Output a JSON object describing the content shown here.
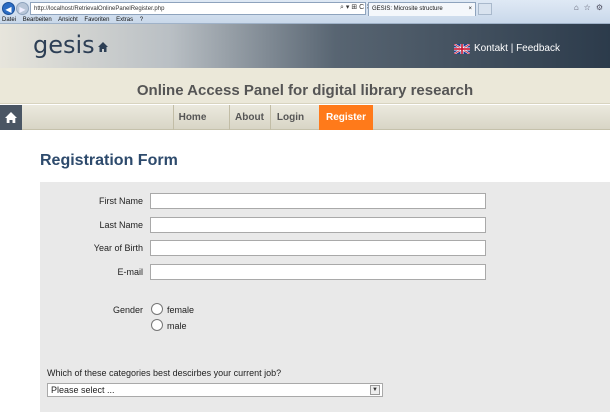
{
  "browser": {
    "url": "http://localhost/RetrievalOnlinePanelRegister.php",
    "address_tools": "⌕ ▾ ⊞ C ✕",
    "tab_title": "GESIS: Microsite structure",
    "tab_close": "×",
    "menu": [
      "Datei",
      "Bearbeiten",
      "Ansicht",
      "Favoriten",
      "Extras",
      "?"
    ]
  },
  "site": {
    "logo_text": "gesis",
    "contact_text": "Kontakt | Feedback",
    "banner_title": "Online Access Panel for digital library research"
  },
  "nav": {
    "items": [
      {
        "label": "Home"
      },
      {
        "label": "About"
      },
      {
        "label": "Login"
      },
      {
        "label": "Register",
        "active": true
      }
    ]
  },
  "form": {
    "title": "Registration Form",
    "fields": {
      "first_name": {
        "label": "First Name",
        "value": ""
      },
      "last_name": {
        "label": "Last Name",
        "value": ""
      },
      "year_of_birth": {
        "label": "Year of Birth",
        "value": ""
      },
      "email": {
        "label": "E-mail",
        "value": ""
      }
    },
    "gender": {
      "label": "Gender",
      "options": [
        "female",
        "male"
      ]
    },
    "job": {
      "question": "Which of these categories best descirbes your current job?",
      "selected": "Please select ..."
    }
  },
  "colors": {
    "active_tab": "#ff7a1a",
    "title_blue": "#2d4a6c"
  }
}
